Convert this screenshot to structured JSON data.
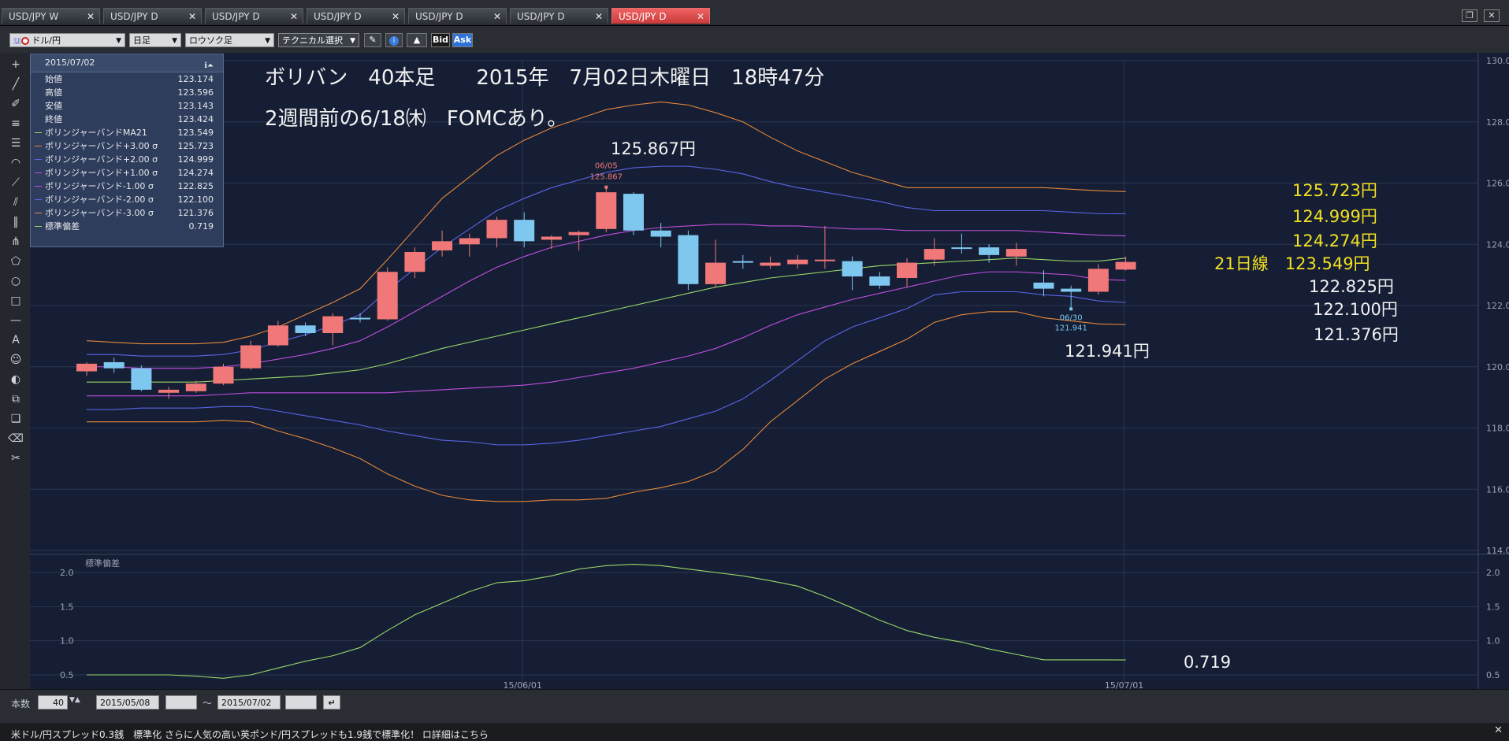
{
  "tabs": [
    {
      "label": "USD/JPY W",
      "active": false
    },
    {
      "label": "USD/JPY D",
      "active": false
    },
    {
      "label": "USD/JPY D",
      "active": false
    },
    {
      "label": "USD/JPY D",
      "active": false
    },
    {
      "label": "USD/JPY D",
      "active": false
    },
    {
      "label": "USD/JPY D",
      "active": false
    },
    {
      "label": "USD/JPY D",
      "active": true
    }
  ],
  "toolbar": {
    "pair": "ドル/円",
    "timeframe": "日足",
    "chart_type": "ロウソク足",
    "technical": "テクニカル選択",
    "bid": "Bid",
    "ask": "Ask"
  },
  "info_panel": {
    "date": "2015/07/02",
    "rows": [
      {
        "label": "始値",
        "value": "123.174",
        "color": ""
      },
      {
        "label": "高値",
        "value": "123.596",
        "color": ""
      },
      {
        "label": "安値",
        "value": "123.143",
        "color": ""
      },
      {
        "label": "終値",
        "value": "123.424",
        "color": ""
      },
      {
        "label": "ボリンジャーバンドMA21",
        "value": "123.549",
        "color": "#9bd86a"
      },
      {
        "label": "ボリンジャーバンド+3.00 σ",
        "value": "125.723",
        "color": "#e8893a"
      },
      {
        "label": "ボリンジャーバンド+2.00 σ",
        "value": "124.999",
        "color": "#5a66e8"
      },
      {
        "label": "ボリンジャーバンド+1.00 σ",
        "value": "124.274",
        "color": "#c04ee0"
      },
      {
        "label": "ボリンジャーバンド-1.00 σ",
        "value": "122.825",
        "color": "#c04ee0"
      },
      {
        "label": "ボリンジャーバンド-2.00 σ",
        "value": "122.100",
        "color": "#5a66e8"
      },
      {
        "label": "ボリンジャーバンド-3.00 σ",
        "value": "121.376",
        "color": "#e8893a"
      },
      {
        "label": "標準偏差",
        "value": "0.719",
        "color": "#9bd86a"
      }
    ]
  },
  "annotations": {
    "title_line1": "ボリバン　40本足　　2015年　7月02日木曜日　18時47分",
    "title_line2": "2週間前の6/18㈭　FOMCあり。",
    "high_label": "125.867円",
    "low_label": "121.941円",
    "mark_high_date": "06/05",
    "mark_high_value": "125.867",
    "mark_low_date": "06/30",
    "mark_low_value": "121.941",
    "band_p3": "125.723円",
    "band_p2": "124.999円",
    "band_p1": "124.274円",
    "ma21": "21日線　123.549円",
    "band_m1": "122.825円",
    "band_m2": "122.100円",
    "band_m3": "121.376円",
    "std_value": "0.719",
    "sub_title": "標準偏差"
  },
  "colors": {
    "up": "#f07878",
    "down": "#7ec8f0",
    "ma": "#9bd86a",
    "sigma1": "#c04ee0",
    "sigma2": "#5a66e8",
    "sigma3": "#e8893a",
    "std": "#9bd86a",
    "highlight": "#f2e020"
  },
  "chart_data": [
    {
      "type": "candlestick",
      "title": "",
      "ylim": [
        114,
        130
      ],
      "yticks": [
        "130.00",
        "128.00",
        "126.00",
        "124.00",
        "122.00",
        "120.00",
        "118.00",
        "116.00",
        "114.00"
      ],
      "xticks": [
        {
          "label": "15/06/01",
          "index": 16
        },
        {
          "label": "15/07/01",
          "index": 38
        }
      ],
      "candles": [
        {
          "o": 119.85,
          "h": 120.15,
          "l": 119.7,
          "c": 120.1
        },
        {
          "o": 120.15,
          "h": 120.3,
          "l": 119.8,
          "c": 119.95
        },
        {
          "o": 119.95,
          "h": 120.05,
          "l": 119.2,
          "c": 119.25
        },
        {
          "o": 119.15,
          "h": 119.35,
          "l": 118.95,
          "c": 119.25
        },
        {
          "o": 119.2,
          "h": 119.55,
          "l": 119.15,
          "c": 119.45
        },
        {
          "o": 119.45,
          "h": 120.1,
          "l": 119.4,
          "c": 120.0
        },
        {
          "o": 119.95,
          "h": 120.85,
          "l": 119.9,
          "c": 120.7
        },
        {
          "o": 120.7,
          "h": 121.5,
          "l": 120.65,
          "c": 121.35
        },
        {
          "o": 121.35,
          "h": 121.45,
          "l": 121.0,
          "c": 121.1
        },
        {
          "o": 121.1,
          "h": 121.75,
          "l": 120.7,
          "c": 121.65
        },
        {
          "o": 121.6,
          "h": 121.75,
          "l": 121.45,
          "c": 121.55
        },
        {
          "o": 121.55,
          "h": 123.25,
          "l": 121.5,
          "c": 123.1
        },
        {
          "o": 123.1,
          "h": 123.9,
          "l": 122.9,
          "c": 123.75
        },
        {
          "o": 123.8,
          "h": 124.45,
          "l": 123.6,
          "c": 124.1
        },
        {
          "o": 124.0,
          "h": 124.35,
          "l": 123.6,
          "c": 124.2
        },
        {
          "o": 124.2,
          "h": 124.9,
          "l": 123.9,
          "c": 124.8
        },
        {
          "o": 124.8,
          "h": 125.05,
          "l": 123.9,
          "c": 124.1
        },
        {
          "o": 124.15,
          "h": 124.3,
          "l": 123.85,
          "c": 124.25
        },
        {
          "o": 124.3,
          "h": 124.45,
          "l": 123.8,
          "c": 124.4
        },
        {
          "o": 124.5,
          "h": 125.867,
          "l": 124.4,
          "c": 125.7
        },
        {
          "o": 125.65,
          "h": 125.7,
          "l": 124.3,
          "c": 124.45
        },
        {
          "o": 124.45,
          "h": 124.7,
          "l": 123.9,
          "c": 124.25
        },
        {
          "o": 124.3,
          "h": 124.45,
          "l": 122.5,
          "c": 122.7
        },
        {
          "o": 122.7,
          "h": 124.15,
          "l": 122.6,
          "c": 123.4
        },
        {
          "o": 123.45,
          "h": 123.65,
          "l": 123.2,
          "c": 123.4
        },
        {
          "o": 123.3,
          "h": 123.6,
          "l": 123.2,
          "c": 123.4
        },
        {
          "o": 123.35,
          "h": 123.65,
          "l": 123.2,
          "c": 123.5
        },
        {
          "o": 123.45,
          "h": 124.6,
          "l": 123.2,
          "c": 123.5
        },
        {
          "o": 123.45,
          "h": 123.6,
          "l": 122.5,
          "c": 122.95
        },
        {
          "o": 122.95,
          "h": 123.1,
          "l": 122.55,
          "c": 122.65
        },
        {
          "o": 122.9,
          "h": 123.55,
          "l": 122.6,
          "c": 123.4
        },
        {
          "o": 123.5,
          "h": 124.2,
          "l": 123.3,
          "c": 123.85
        },
        {
          "o": 123.9,
          "h": 124.35,
          "l": 123.7,
          "c": 123.85
        },
        {
          "o": 123.9,
          "h": 124.0,
          "l": 123.4,
          "c": 123.65
        },
        {
          "o": 123.6,
          "h": 124.05,
          "l": 123.3,
          "c": 123.85
        },
        {
          "o": 122.75,
          "h": 123.15,
          "l": 122.3,
          "c": 122.55
        },
        {
          "o": 122.55,
          "h": 122.65,
          "l": 121.941,
          "c": 122.45
        },
        {
          "o": 122.45,
          "h": 123.35,
          "l": 122.35,
          "c": 123.2
        },
        {
          "o": 123.174,
          "h": 123.596,
          "l": 123.143,
          "c": 123.424
        }
      ],
      "series": [
        {
          "name": "ボリンジャーバンドMA21",
          "values": [
            119.5,
            119.5,
            119.5,
            119.5,
            119.5,
            119.55,
            119.6,
            119.65,
            119.7,
            119.8,
            119.9,
            120.1,
            120.35,
            120.6,
            120.8,
            121.0,
            121.2,
            121.4,
            121.6,
            121.8,
            122.0,
            122.2,
            122.4,
            122.6,
            122.75,
            122.9,
            123.0,
            123.1,
            123.2,
            123.3,
            123.35,
            123.4,
            123.45,
            123.5,
            123.55,
            123.5,
            123.45,
            123.45,
            123.549
          ]
        },
        {
          "name": "ボリンジャーバンド+1.00 σ",
          "values": [
            120.0,
            120.0,
            119.95,
            119.95,
            119.95,
            120.0,
            120.1,
            120.25,
            120.4,
            120.6,
            120.85,
            121.3,
            121.8,
            122.3,
            122.8,
            123.25,
            123.6,
            123.9,
            124.1,
            124.3,
            124.45,
            124.55,
            124.6,
            124.65,
            124.65,
            124.6,
            124.6,
            124.55,
            124.5,
            124.5,
            124.45,
            124.45,
            124.45,
            124.45,
            124.45,
            124.4,
            124.35,
            124.3,
            124.274
          ]
        },
        {
          "name": "ボリンジャーバンド+2.00 σ",
          "values": [
            120.4,
            120.4,
            120.35,
            120.35,
            120.35,
            120.4,
            120.55,
            120.8,
            121.05,
            121.35,
            121.7,
            122.5,
            123.2,
            123.9,
            124.5,
            125.1,
            125.5,
            125.85,
            126.1,
            126.35,
            126.5,
            126.55,
            126.55,
            126.45,
            126.3,
            126.05,
            125.85,
            125.7,
            125.55,
            125.4,
            125.2,
            125.1,
            125.1,
            125.1,
            125.1,
            125.1,
            125.05,
            125.0,
            124.999
          ]
        },
        {
          "name": "ボリンジャーバンド+3.00 σ",
          "values": [
            120.85,
            120.8,
            120.75,
            120.75,
            120.75,
            120.8,
            121.0,
            121.3,
            121.7,
            122.1,
            122.55,
            123.5,
            124.5,
            125.5,
            126.2,
            126.9,
            127.4,
            127.8,
            128.1,
            128.4,
            128.55,
            128.65,
            128.55,
            128.3,
            128.0,
            127.5,
            127.05,
            126.7,
            126.35,
            126.1,
            125.85,
            125.85,
            125.85,
            125.85,
            125.85,
            125.85,
            125.8,
            125.75,
            125.723
          ]
        },
        {
          "name": "ボリンジャーバンド-1.00 σ",
          "values": [
            119.05,
            119.05,
            119.05,
            119.05,
            119.05,
            119.1,
            119.15,
            119.15,
            119.15,
            119.15,
            119.15,
            119.15,
            119.2,
            119.25,
            119.3,
            119.35,
            119.4,
            119.5,
            119.65,
            119.8,
            119.95,
            120.15,
            120.35,
            120.6,
            120.95,
            121.35,
            121.7,
            121.95,
            122.2,
            122.4,
            122.6,
            122.8,
            123.0,
            123.1,
            123.1,
            123.05,
            123.0,
            122.85,
            122.825
          ]
        },
        {
          "name": "ボリンジャーバンド-2.00 σ",
          "values": [
            118.6,
            118.6,
            118.65,
            118.65,
            118.65,
            118.7,
            118.7,
            118.55,
            118.4,
            118.25,
            118.1,
            117.9,
            117.75,
            117.6,
            117.55,
            117.45,
            117.45,
            117.5,
            117.6,
            117.75,
            117.9,
            118.05,
            118.3,
            118.55,
            118.95,
            119.55,
            120.2,
            120.85,
            121.3,
            121.6,
            121.9,
            122.35,
            122.45,
            122.45,
            122.45,
            122.35,
            122.3,
            122.15,
            122.1
          ]
        },
        {
          "name": "ボリンジャーバンド-3.00 σ",
          "values": [
            118.2,
            118.2,
            118.2,
            118.2,
            118.2,
            118.25,
            118.2,
            117.9,
            117.65,
            117.35,
            117.0,
            116.5,
            116.1,
            115.8,
            115.65,
            115.6,
            115.6,
            115.65,
            115.65,
            115.7,
            115.9,
            116.05,
            116.25,
            116.6,
            117.3,
            118.2,
            118.9,
            119.6,
            120.1,
            120.5,
            120.9,
            121.45,
            121.7,
            121.8,
            121.8,
            121.6,
            121.5,
            121.4,
            121.376
          ]
        }
      ]
    },
    {
      "type": "line",
      "title": "標準偏差",
      "ylim": [
        0.35,
        2.15
      ],
      "yticks": [
        "2.0",
        "1.5",
        "1.0",
        "0.5"
      ],
      "series": [
        {
          "name": "標準偏差",
          "values": [
            0.5,
            0.5,
            0.5,
            0.5,
            0.48,
            0.45,
            0.5,
            0.6,
            0.7,
            0.78,
            0.9,
            1.15,
            1.38,
            1.55,
            1.72,
            1.85,
            1.88,
            1.95,
            2.05,
            2.1,
            2.12,
            2.1,
            2.05,
            2.0,
            1.95,
            1.88,
            1.8,
            1.65,
            1.48,
            1.3,
            1.15,
            1.05,
            0.98,
            0.88,
            0.8,
            0.72,
            0.72,
            0.72,
            0.719
          ]
        }
      ]
    }
  ],
  "bottom": {
    "count_label": "本数",
    "count_value": "40",
    "date_from": "2015/05/08",
    "tilde": "～",
    "date_to": "2015/07/02"
  },
  "ticker": "米ドル/円スプレッド0.3銭　標準化 さらに人気の高い英ポンド/円スプレッドも1.9銭で標準化！ ロ詳細はこちら"
}
